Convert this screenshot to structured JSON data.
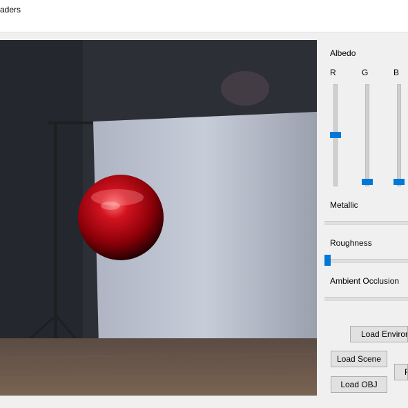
{
  "window": {
    "title": "aders"
  },
  "panel": {
    "albedo_label": "Albedo",
    "channels": [
      {
        "label": "R",
        "value": 0.5
      },
      {
        "label": "G",
        "value": 0.05
      },
      {
        "label": "B",
        "value": 0.05
      }
    ],
    "metallic_label": "Metallic",
    "roughness_label": "Roughness",
    "roughness_value": 0.0,
    "ao_label": "Ambient Occlusion"
  },
  "buttons": {
    "load_environment": "Load Environn",
    "load_scene": "Load Scene",
    "load_obj": "Load OBJ",
    "reset": "R"
  },
  "colors": {
    "accent": "#0078d7",
    "sphere": "#b0000a"
  }
}
